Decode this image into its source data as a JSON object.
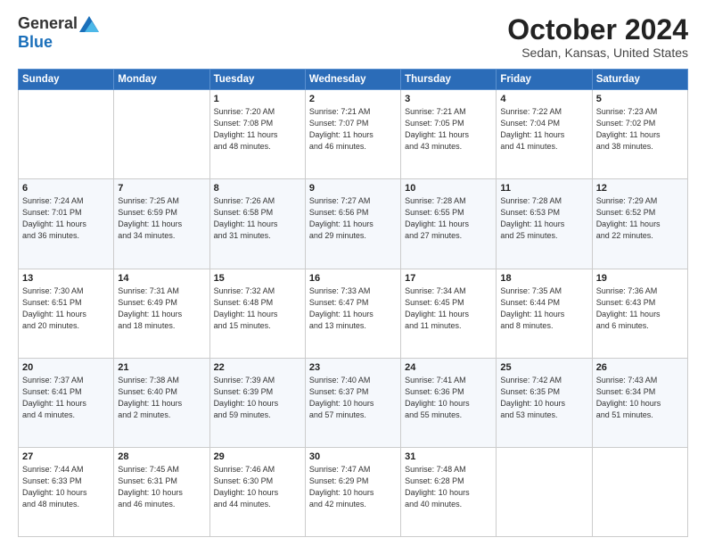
{
  "header": {
    "logo_general": "General",
    "logo_blue": "Blue",
    "month_title": "October 2024",
    "location": "Sedan, Kansas, United States"
  },
  "weekdays": [
    "Sunday",
    "Monday",
    "Tuesday",
    "Wednesday",
    "Thursday",
    "Friday",
    "Saturday"
  ],
  "weeks": [
    [
      {
        "day": "",
        "info": ""
      },
      {
        "day": "",
        "info": ""
      },
      {
        "day": "1",
        "info": "Sunrise: 7:20 AM\nSunset: 7:08 PM\nDaylight: 11 hours\nand 48 minutes."
      },
      {
        "day": "2",
        "info": "Sunrise: 7:21 AM\nSunset: 7:07 PM\nDaylight: 11 hours\nand 46 minutes."
      },
      {
        "day": "3",
        "info": "Sunrise: 7:21 AM\nSunset: 7:05 PM\nDaylight: 11 hours\nand 43 minutes."
      },
      {
        "day": "4",
        "info": "Sunrise: 7:22 AM\nSunset: 7:04 PM\nDaylight: 11 hours\nand 41 minutes."
      },
      {
        "day": "5",
        "info": "Sunrise: 7:23 AM\nSunset: 7:02 PM\nDaylight: 11 hours\nand 38 minutes."
      }
    ],
    [
      {
        "day": "6",
        "info": "Sunrise: 7:24 AM\nSunset: 7:01 PM\nDaylight: 11 hours\nand 36 minutes."
      },
      {
        "day": "7",
        "info": "Sunrise: 7:25 AM\nSunset: 6:59 PM\nDaylight: 11 hours\nand 34 minutes."
      },
      {
        "day": "8",
        "info": "Sunrise: 7:26 AM\nSunset: 6:58 PM\nDaylight: 11 hours\nand 31 minutes."
      },
      {
        "day": "9",
        "info": "Sunrise: 7:27 AM\nSunset: 6:56 PM\nDaylight: 11 hours\nand 29 minutes."
      },
      {
        "day": "10",
        "info": "Sunrise: 7:28 AM\nSunset: 6:55 PM\nDaylight: 11 hours\nand 27 minutes."
      },
      {
        "day": "11",
        "info": "Sunrise: 7:28 AM\nSunset: 6:53 PM\nDaylight: 11 hours\nand 25 minutes."
      },
      {
        "day": "12",
        "info": "Sunrise: 7:29 AM\nSunset: 6:52 PM\nDaylight: 11 hours\nand 22 minutes."
      }
    ],
    [
      {
        "day": "13",
        "info": "Sunrise: 7:30 AM\nSunset: 6:51 PM\nDaylight: 11 hours\nand 20 minutes."
      },
      {
        "day": "14",
        "info": "Sunrise: 7:31 AM\nSunset: 6:49 PM\nDaylight: 11 hours\nand 18 minutes."
      },
      {
        "day": "15",
        "info": "Sunrise: 7:32 AM\nSunset: 6:48 PM\nDaylight: 11 hours\nand 15 minutes."
      },
      {
        "day": "16",
        "info": "Sunrise: 7:33 AM\nSunset: 6:47 PM\nDaylight: 11 hours\nand 13 minutes."
      },
      {
        "day": "17",
        "info": "Sunrise: 7:34 AM\nSunset: 6:45 PM\nDaylight: 11 hours\nand 11 minutes."
      },
      {
        "day": "18",
        "info": "Sunrise: 7:35 AM\nSunset: 6:44 PM\nDaylight: 11 hours\nand 8 minutes."
      },
      {
        "day": "19",
        "info": "Sunrise: 7:36 AM\nSunset: 6:43 PM\nDaylight: 11 hours\nand 6 minutes."
      }
    ],
    [
      {
        "day": "20",
        "info": "Sunrise: 7:37 AM\nSunset: 6:41 PM\nDaylight: 11 hours\nand 4 minutes."
      },
      {
        "day": "21",
        "info": "Sunrise: 7:38 AM\nSunset: 6:40 PM\nDaylight: 11 hours\nand 2 minutes."
      },
      {
        "day": "22",
        "info": "Sunrise: 7:39 AM\nSunset: 6:39 PM\nDaylight: 10 hours\nand 59 minutes."
      },
      {
        "day": "23",
        "info": "Sunrise: 7:40 AM\nSunset: 6:37 PM\nDaylight: 10 hours\nand 57 minutes."
      },
      {
        "day": "24",
        "info": "Sunrise: 7:41 AM\nSunset: 6:36 PM\nDaylight: 10 hours\nand 55 minutes."
      },
      {
        "day": "25",
        "info": "Sunrise: 7:42 AM\nSunset: 6:35 PM\nDaylight: 10 hours\nand 53 minutes."
      },
      {
        "day": "26",
        "info": "Sunrise: 7:43 AM\nSunset: 6:34 PM\nDaylight: 10 hours\nand 51 minutes."
      }
    ],
    [
      {
        "day": "27",
        "info": "Sunrise: 7:44 AM\nSunset: 6:33 PM\nDaylight: 10 hours\nand 48 minutes."
      },
      {
        "day": "28",
        "info": "Sunrise: 7:45 AM\nSunset: 6:31 PM\nDaylight: 10 hours\nand 46 minutes."
      },
      {
        "day": "29",
        "info": "Sunrise: 7:46 AM\nSunset: 6:30 PM\nDaylight: 10 hours\nand 44 minutes."
      },
      {
        "day": "30",
        "info": "Sunrise: 7:47 AM\nSunset: 6:29 PM\nDaylight: 10 hours\nand 42 minutes."
      },
      {
        "day": "31",
        "info": "Sunrise: 7:48 AM\nSunset: 6:28 PM\nDaylight: 10 hours\nand 40 minutes."
      },
      {
        "day": "",
        "info": ""
      },
      {
        "day": "",
        "info": ""
      }
    ]
  ]
}
